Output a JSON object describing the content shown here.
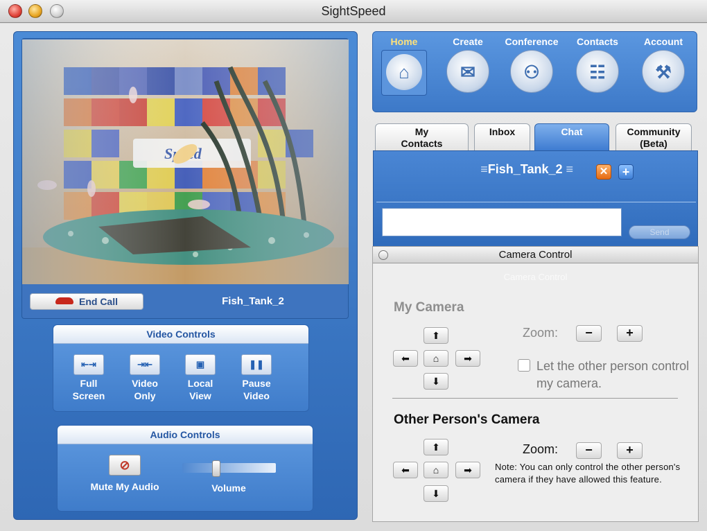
{
  "window": {
    "title": "SightSpeed"
  },
  "video": {
    "end_call_label": "End Call",
    "caller_name": "Fish_Tank_2"
  },
  "video_controls": {
    "title": "Video Controls",
    "buttons": [
      {
        "label_line1": "Full",
        "label_line2": "Screen",
        "icon": "fullscreen-icon"
      },
      {
        "label_line1": "Video",
        "label_line2": "Only",
        "icon": "video-only-icon"
      },
      {
        "label_line1": "Local",
        "label_line2": "View",
        "icon": "local-view-icon"
      },
      {
        "label_line1": "Pause",
        "label_line2": "Video",
        "icon": "pause-icon"
      }
    ]
  },
  "audio_controls": {
    "title": "Audio Controls",
    "mute_label": "Mute My Audio",
    "volume_label": "Volume",
    "volume_level": 0.35
  },
  "nav": {
    "items": [
      {
        "label": "Home",
        "icon": "home-icon",
        "active": true
      },
      {
        "label": "Create",
        "icon": "webcam-mail-icon",
        "active": false
      },
      {
        "label": "Conference",
        "icon": "people-icon",
        "active": false
      },
      {
        "label": "Contacts",
        "icon": "contact-card-icon",
        "active": false
      },
      {
        "label": "Account",
        "icon": "tools-icon",
        "active": false
      }
    ]
  },
  "tabs": [
    {
      "line1": "My",
      "line2": "Contacts"
    },
    {
      "line1": "Inbox",
      "line2": ""
    },
    {
      "line1": "Chat",
      "line2": ""
    },
    {
      "line1": "Community",
      "line2": "(Beta)"
    }
  ],
  "chat": {
    "contact": "Fish_Tank_2",
    "input_value": "",
    "send_label": "Send"
  },
  "camera_control": {
    "window_title": "Camera Control",
    "ghost_title": "Camera Control",
    "my_camera": {
      "heading": "My Camera",
      "zoom_label": "Zoom:",
      "permission_label": "Let the other person control my camera.",
      "permission_checked": false
    },
    "other_camera": {
      "heading": "Other Person's Camera",
      "zoom_label": "Zoom:",
      "note": "Note: You can only control the other person's camera if they have allowed this feature."
    },
    "glyphs": {
      "up": "⬆",
      "down": "⬇",
      "left": "⬅",
      "right": "➡",
      "home": "⌂",
      "minus": "−",
      "plus": "+"
    }
  },
  "colors": {
    "panel_blue": "#2e67b4",
    "active_nav_text": "#ffe27a",
    "close_orange": "#e56a12"
  }
}
